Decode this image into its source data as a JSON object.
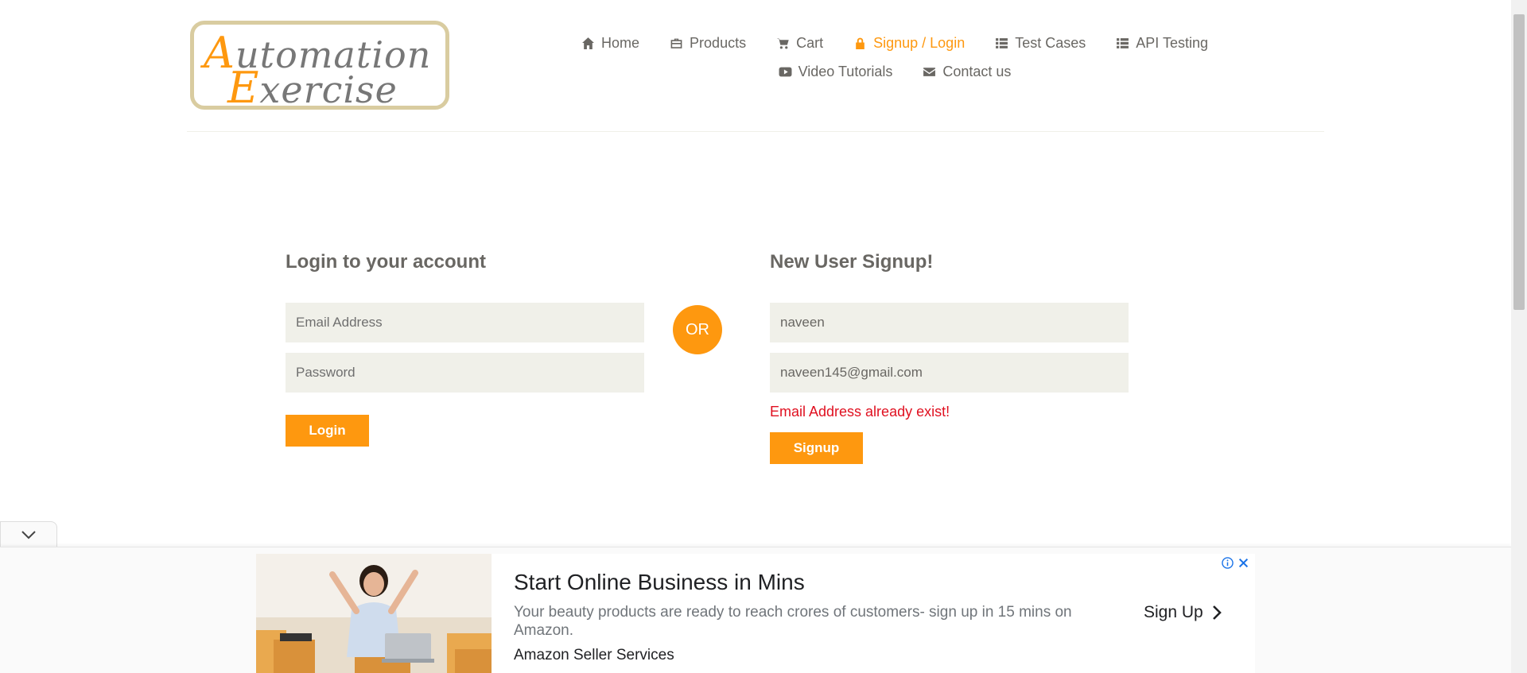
{
  "logo": {
    "line1_cap": "A",
    "line1_rest": "utomation",
    "line2_cap": "E",
    "line2_rest": "xercise"
  },
  "nav": {
    "row1": [
      {
        "label": "Home",
        "icon": "home-icon",
        "active": false
      },
      {
        "label": "Products",
        "icon": "briefcase-icon",
        "active": false
      },
      {
        "label": "Cart",
        "icon": "cart-icon",
        "active": false
      },
      {
        "label": "Signup / Login",
        "icon": "lock-icon",
        "active": true
      },
      {
        "label": "Test Cases",
        "icon": "list-icon",
        "active": false
      },
      {
        "label": "API Testing",
        "icon": "list-icon",
        "active": false
      }
    ],
    "row2": [
      {
        "label": "Video Tutorials",
        "icon": "youtube-play-icon",
        "active": false
      },
      {
        "label": "Contact us",
        "icon": "envelope-icon",
        "active": false
      }
    ]
  },
  "login": {
    "title": "Login to your account",
    "email_placeholder": "Email Address",
    "password_placeholder": "Password",
    "button": "Login"
  },
  "or_label": "OR",
  "signup": {
    "title": "New User Signup!",
    "name_value": "naveen",
    "email_value": "naveen145@gmail.com",
    "error": "Email Address already exist!",
    "button": "Signup"
  },
  "ad": {
    "title": "Start Online Business in Mins",
    "description": "Your beauty products are ready to reach crores of customers- sign up in 15 mins on Amazon.",
    "source": "Amazon Seller Services",
    "cta": "Sign Up"
  },
  "colors": {
    "accent": "#FE980F",
    "field_bg": "#F0F0E9",
    "error": "#E01020",
    "text": "#696763"
  }
}
